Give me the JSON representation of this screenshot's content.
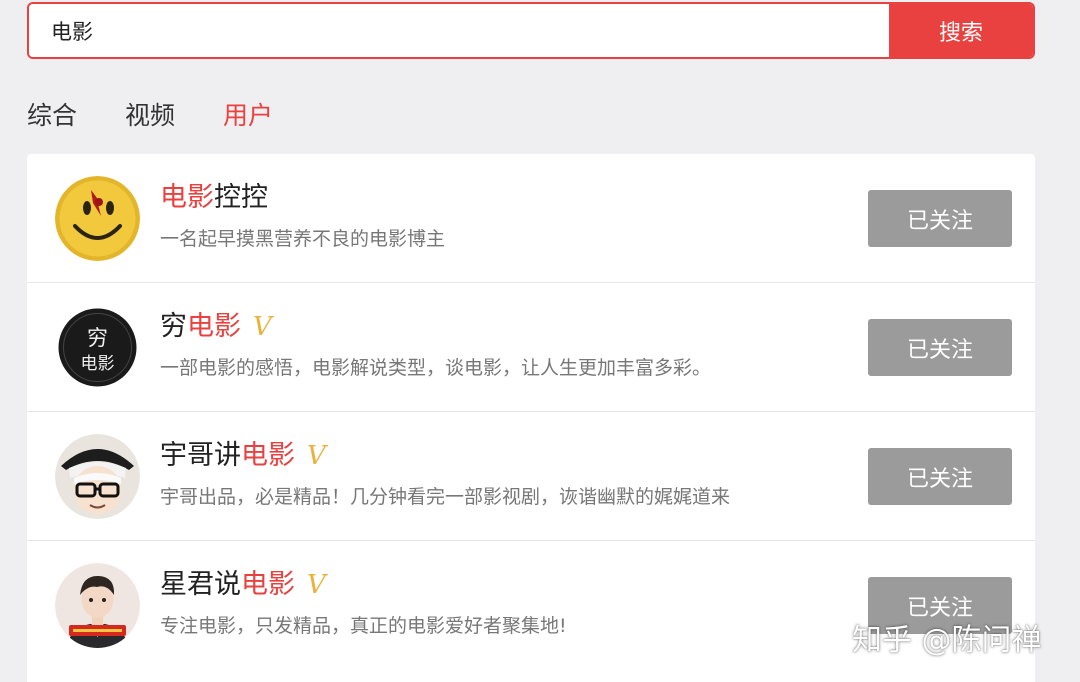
{
  "search": {
    "value": "电影",
    "button_label": "搜索"
  },
  "tabs": [
    {
      "label": "综合",
      "active": false
    },
    {
      "label": "视频",
      "active": false
    },
    {
      "label": "用户",
      "active": true
    }
  ],
  "users": [
    {
      "name_highlight": "电影",
      "name_rest": "控控",
      "verified": false,
      "desc": "一名起早摸黑营养不良的电影博主",
      "follow_label": "已关注",
      "avatar_icon": "smiley-face-avatar"
    },
    {
      "name_prefix": "穷",
      "name_highlight": "电影",
      "verified": true,
      "badge": "V",
      "desc": "一部电影的感悟，电影解说类型，谈电影，让人生更加丰富多彩。",
      "follow_label": "已关注",
      "avatar_icon": "calligraphy-logo-avatar",
      "avatar_text_top": "穷",
      "avatar_text_bottom": "电影"
    },
    {
      "name_prefix": "宇哥讲",
      "name_highlight": "电影",
      "verified": true,
      "badge": "V",
      "desc": "宇哥出品，必是精品！几分钟看完一部影视剧，诙谐幽默的娓娓道来",
      "follow_label": "已关注",
      "avatar_icon": "cartoon-man-glasses-avatar"
    },
    {
      "name_prefix": "星君说",
      "name_highlight": "电影",
      "verified": true,
      "badge": "V",
      "desc": "专注电影，只发精品，真正的电影爱好者聚集地!",
      "follow_label": "已关注",
      "avatar_icon": "cartoon-man-suit-avatar"
    }
  ],
  "watermark": "知乎 @陈问禅",
  "colors": {
    "accent": "#e8413f",
    "verified": "#e8b23c",
    "followed_button": "#9b9b9b"
  }
}
